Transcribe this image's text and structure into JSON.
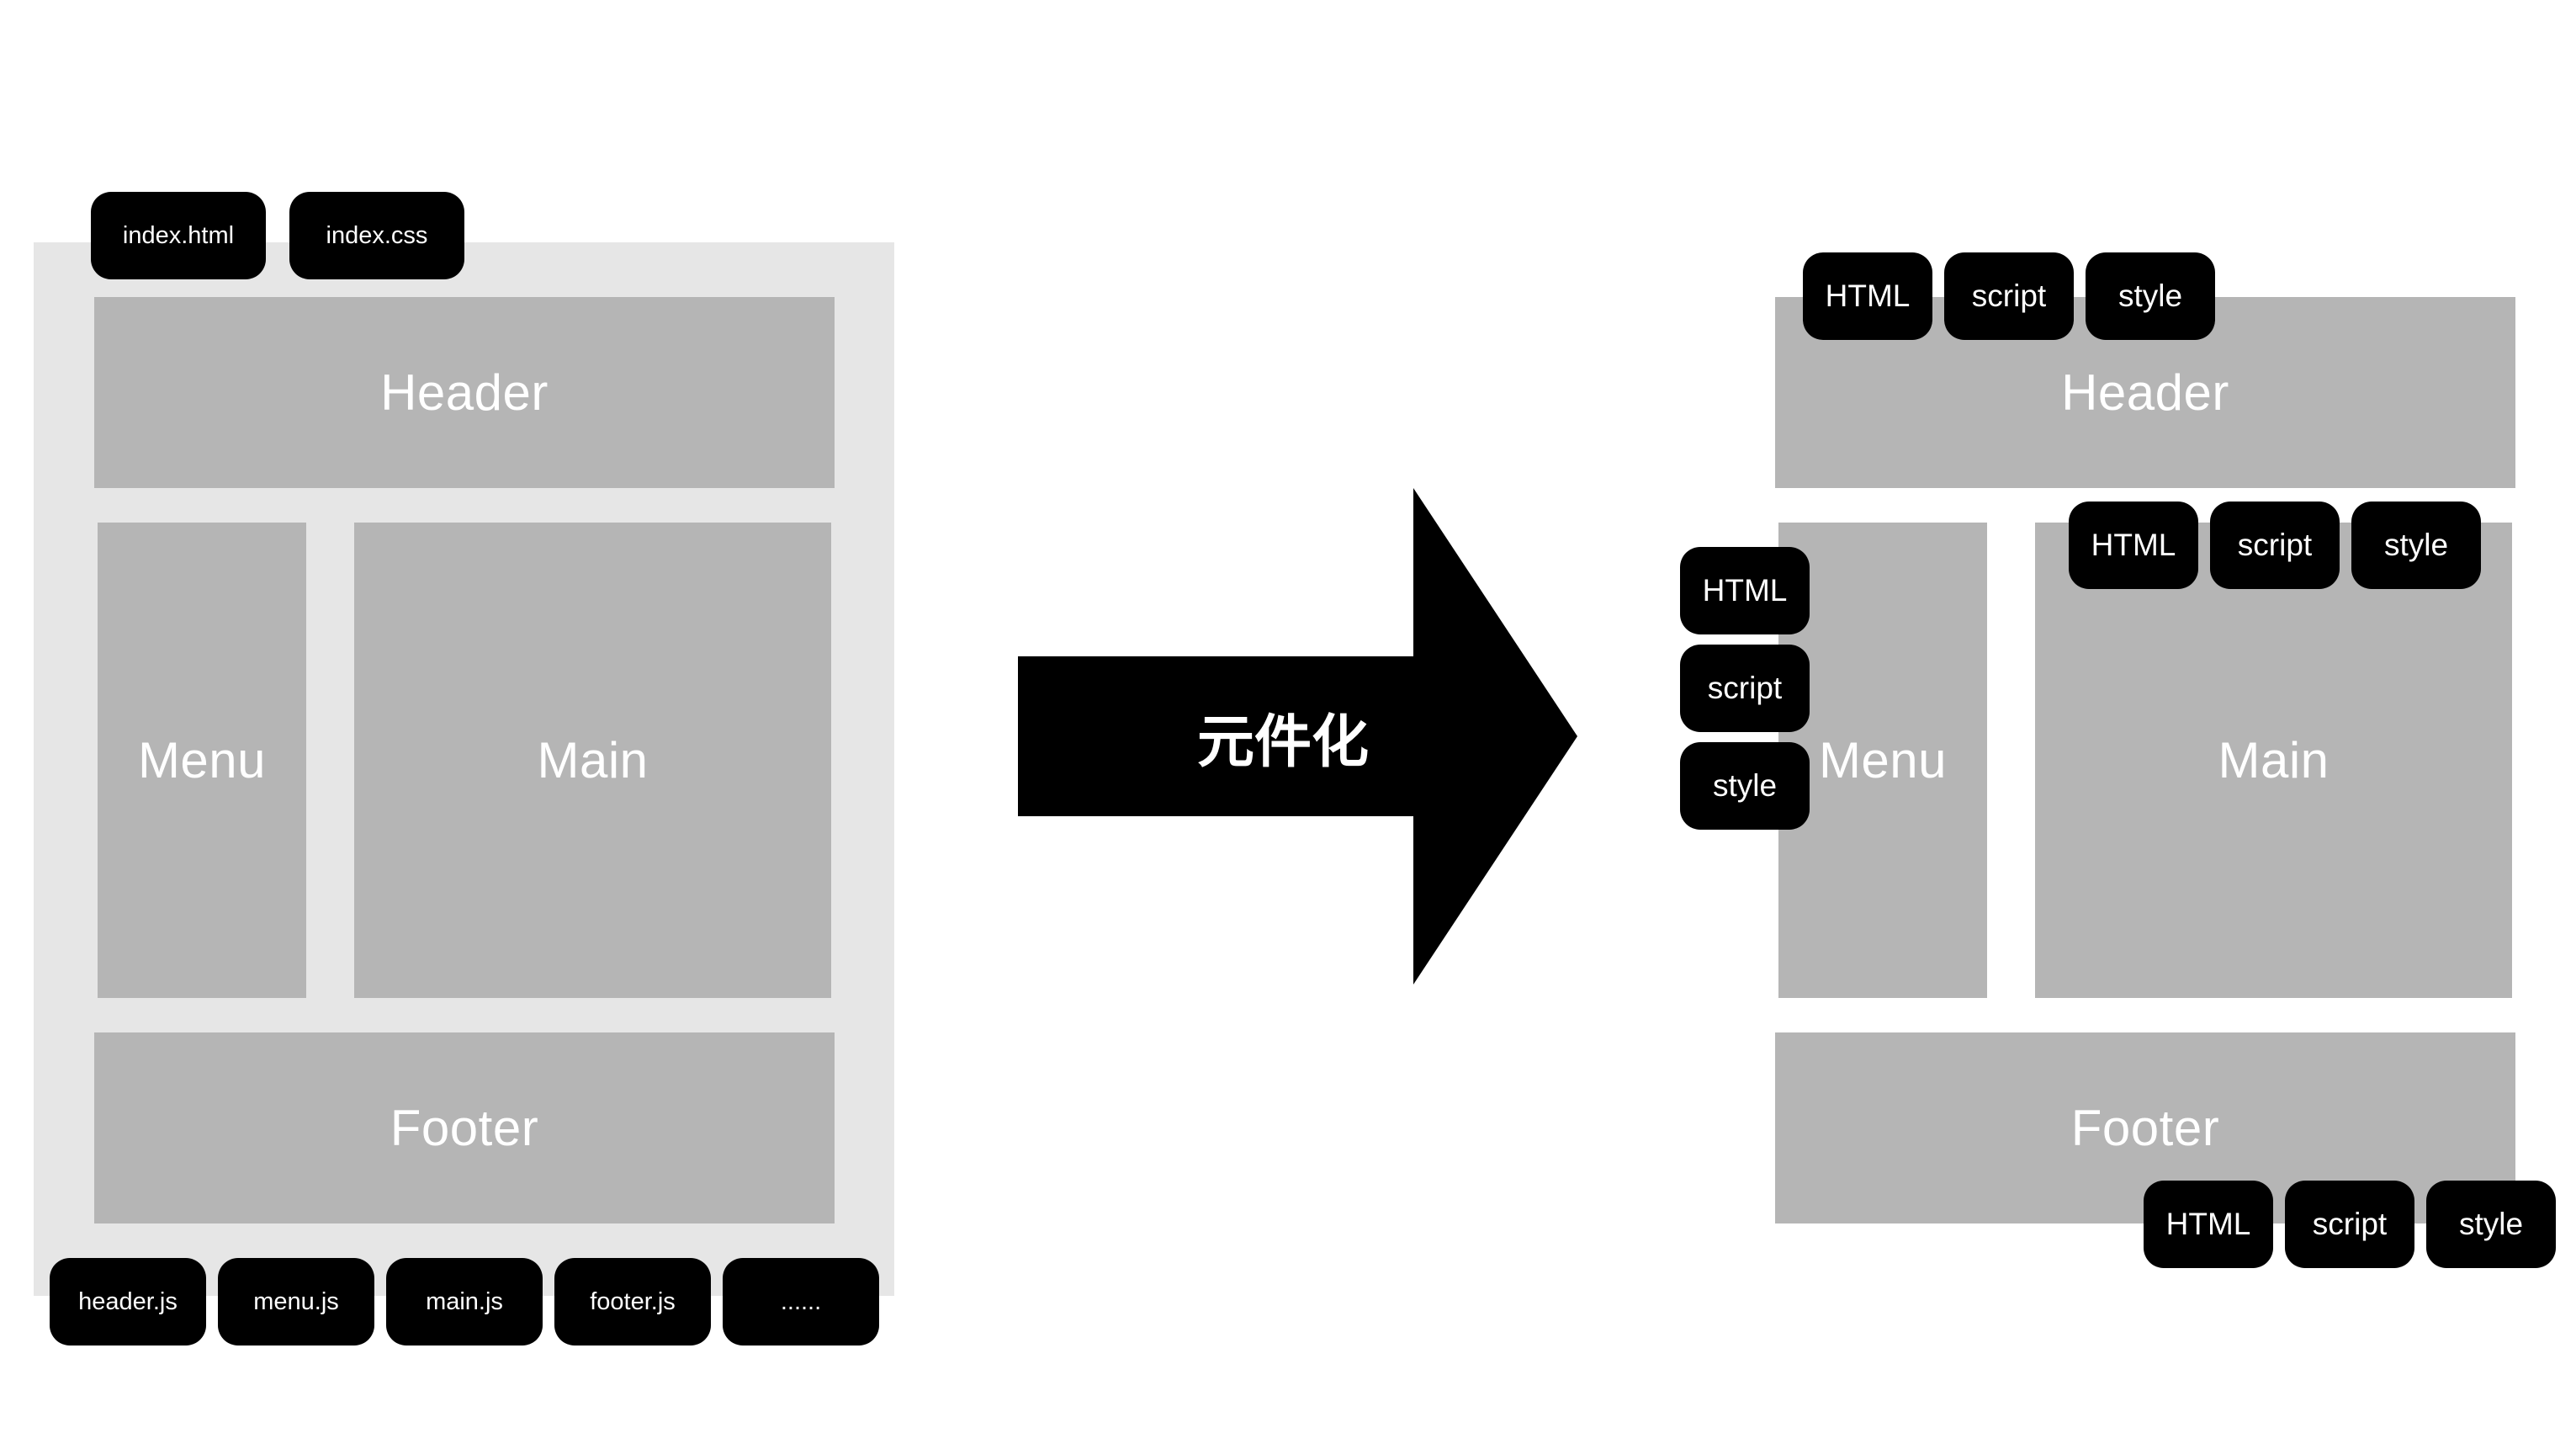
{
  "left_layout": {
    "top_files": [
      "index.html",
      "index.css"
    ],
    "blocks": {
      "header": "Header",
      "menu": "Menu",
      "main": "Main",
      "footer": "Footer"
    },
    "bottom_files": [
      "header.js",
      "menu.js",
      "main.js",
      "footer.js",
      "......"
    ]
  },
  "arrow": {
    "label": "元件化"
  },
  "right_layout": {
    "blocks": {
      "header": "Header",
      "menu": "Menu",
      "main": "Main",
      "footer": "Footer"
    },
    "header_tags": [
      "HTML",
      "script",
      "style"
    ],
    "menu_tags": [
      "HTML",
      "script",
      "style"
    ],
    "main_tags": [
      "HTML",
      "script",
      "style"
    ],
    "footer_tags": [
      "HTML",
      "script",
      "style"
    ]
  },
  "colors": {
    "frame": "#e6e6e6",
    "block": "#b5b5b5",
    "tag": "#000000",
    "text": "#ffffff"
  }
}
